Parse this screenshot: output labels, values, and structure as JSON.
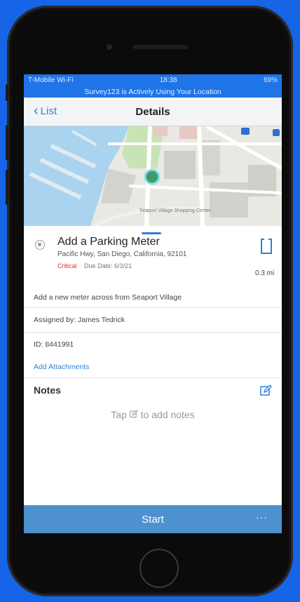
{
  "status_bar": {
    "carrier": "T-Mobile Wi-Fi",
    "time": "18:38",
    "battery": "69%"
  },
  "location_banner": "Survey123 is Actively Using Your Location",
  "nav": {
    "back_label": "List",
    "title": "Details"
  },
  "map": {
    "labels": [
      "Seaport Village Shopping Center"
    ],
    "marker_color": "#3f9b6d"
  },
  "task": {
    "title": "Add a Parking Meter",
    "address": "Pacific Hwy, San Diego, California, 92101",
    "priority": "Critical",
    "due": "Due Date: 6/3/21",
    "distance": "0.3 mi",
    "description": "Add a new meter across from Seaport Village",
    "assigned_by": "Assigned by: James Tedrick",
    "id_line": "ID: 8441991",
    "attachments_link": "Add Attachments"
  },
  "notes": {
    "title": "Notes",
    "placeholder_before": "Tap",
    "placeholder_after": "to add notes"
  },
  "footer": {
    "start_label": "Start",
    "more_label": "···"
  },
  "colors": {
    "accent": "#2f7fd6",
    "status_blue": "#1f74e8",
    "start_bar": "#4d92cf",
    "critical": "#d9352b"
  }
}
